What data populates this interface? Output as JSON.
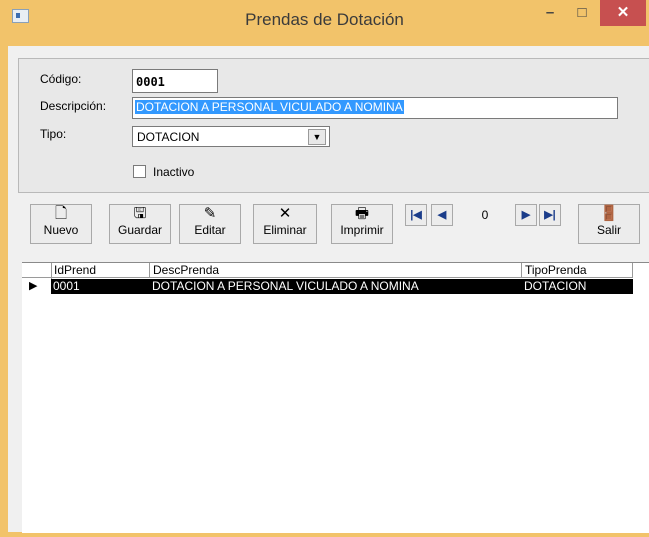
{
  "window": {
    "title": "Prendas de Dotación",
    "minimize_glyph": "–",
    "maximize_glyph": "□",
    "close_glyph": "✕"
  },
  "form": {
    "codigo_label": "Código:",
    "codigo_value": "0001",
    "descripcion_label": "Descripción:",
    "descripcion_value": "DOTACION A PERSONAL VICULADO A NOMINA",
    "tipo_label": "Tipo:",
    "tipo_value": "DOTACION",
    "inactivo_label": "Inactivo",
    "inactivo_checked": false
  },
  "toolbar": {
    "nuevo": "Nuevo",
    "guardar": "Guardar",
    "editar": "Editar",
    "eliminar": "Eliminar",
    "imprimir": "Imprimir",
    "salir": "Salir",
    "record_position": "0"
  },
  "grid": {
    "columns": [
      "IdPrend",
      "DescPrenda",
      "TipoPrenda"
    ],
    "rows": [
      {
        "IdPrend": "0001",
        "DescPrenda": "DOTACION A PERSONAL VICULADO A NOMINA",
        "TipoPrenda": "DOTACION"
      }
    ]
  },
  "colors": {
    "frame_accent": "#f2c36a",
    "close_button": "#c75050",
    "selection_blue": "#3399ff",
    "selected_row": "#000000"
  }
}
